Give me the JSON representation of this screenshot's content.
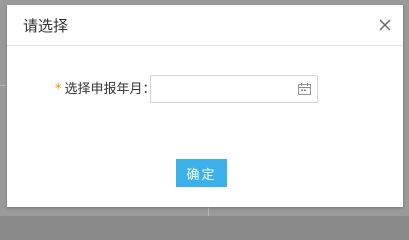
{
  "dialog": {
    "title": "请选择",
    "close_icon": "close-icon"
  },
  "form": {
    "required_mark": "*",
    "label": "选择申报年月：",
    "date_value": "",
    "date_placeholder": "",
    "calendar_icon": "calendar-icon"
  },
  "actions": {
    "confirm_label": "确定"
  },
  "colors": {
    "accent": "#3cb1e9",
    "required": "#f08c00"
  }
}
